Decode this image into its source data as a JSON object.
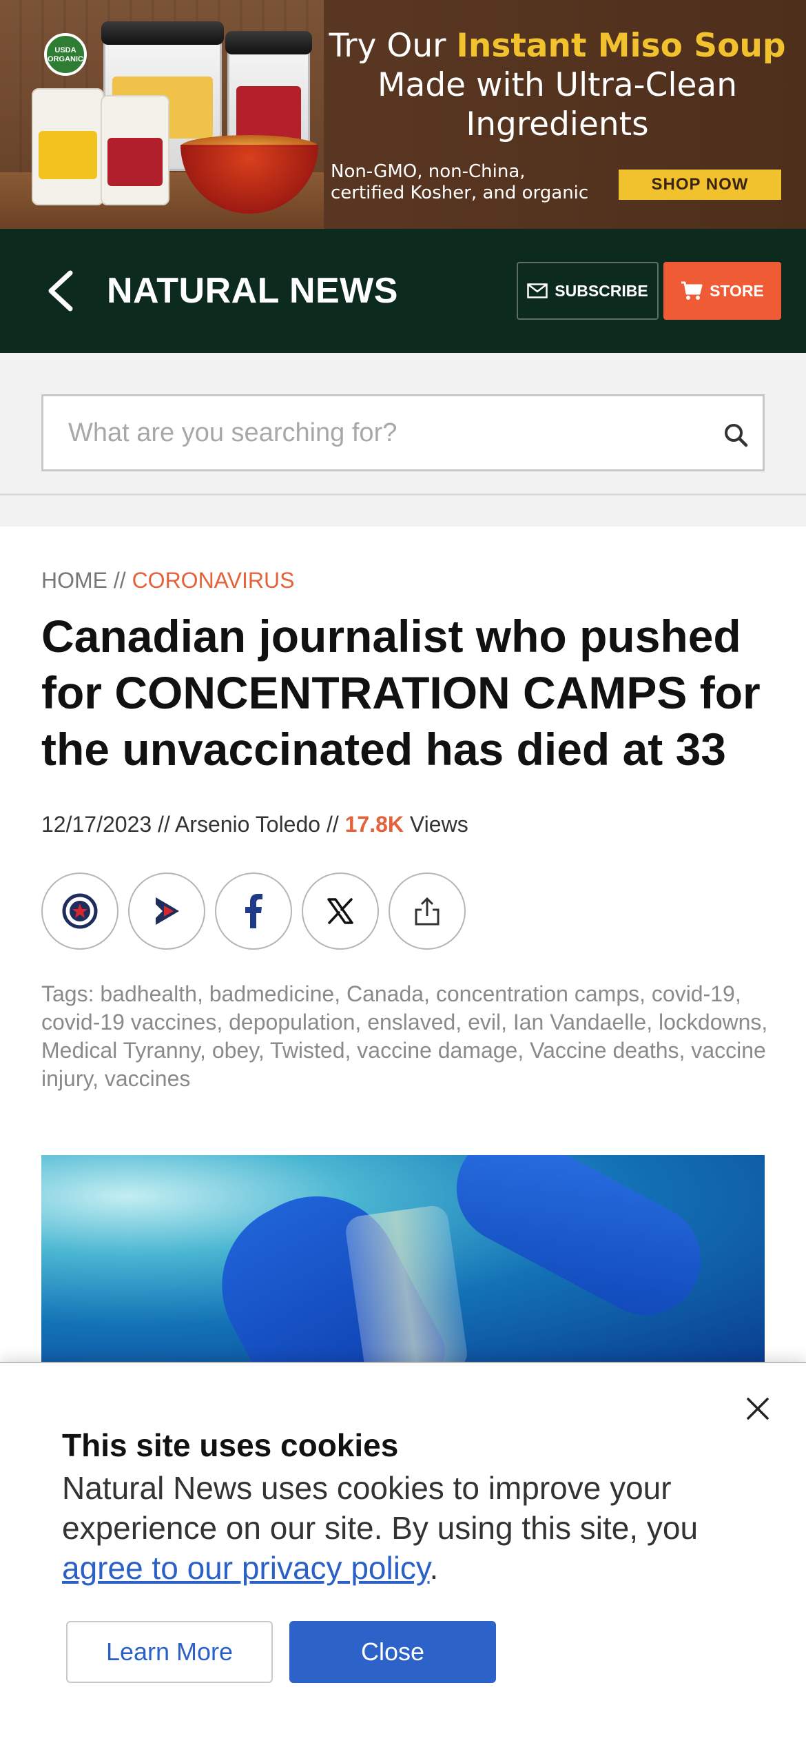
{
  "ad": {
    "badge": "USDA ORGANIC",
    "headline_pre": "Try Our ",
    "headline_highlight": "Instant Miso Soup",
    "headline_rest": "Made with Ultra-Clean Ingredients",
    "sub_line1": "Non-GMO, non-China,",
    "sub_line2": "certified Kosher, and organic",
    "cta": "SHOP NOW"
  },
  "header": {
    "brand": "NATURAL NEWS",
    "subscribe_label": "SUBSCRIBE",
    "store_label": "STORE"
  },
  "search": {
    "placeholder": "What are you searching for?"
  },
  "breadcrumb": {
    "home": "HOME",
    "separator": " // ",
    "category": "CORONAVIRUS"
  },
  "article": {
    "title": "Canadian journalist who pushed for CONCENTRATION CAMPS for the unvaccinated has died at 33",
    "date": "12/17/2023",
    "author": "Arsenio Toledo",
    "meta_sep": " // ",
    "views_count": "17.8K",
    "views_label": " Views",
    "tags_label": "Tags: ",
    "tags": [
      "badhealth",
      "badmedicine",
      "Canada",
      "concentration camps",
      "covid-19",
      "covid-19 vaccines",
      "depopulation",
      "enslaved",
      "evil",
      "Ian Vandaelle",
      "lockdowns",
      "Medical Tyranny",
      "obey",
      "Twisted",
      "vaccine damage",
      "Vaccine deaths",
      "vaccine injury",
      "vaccines"
    ]
  },
  "share": [
    {
      "name": "brighteon-share-icon"
    },
    {
      "name": "video-share-icon"
    },
    {
      "name": "facebook-share-icon"
    },
    {
      "name": "x-share-icon"
    },
    {
      "name": "share-export-icon"
    }
  ],
  "cookie": {
    "title": "This site uses cookies",
    "text": "Natural News uses cookies to improve your experience on our site. By using this site, you ",
    "link_text": "agree to our privacy policy",
    "text_end": ".",
    "learn_more": "Learn More",
    "close": "Close"
  },
  "colors": {
    "header_bg": "#0c2a1e",
    "accent_orange": "#ef5b34",
    "link_blue": "#2b61c6",
    "ad_yellow": "#f2c12e"
  }
}
